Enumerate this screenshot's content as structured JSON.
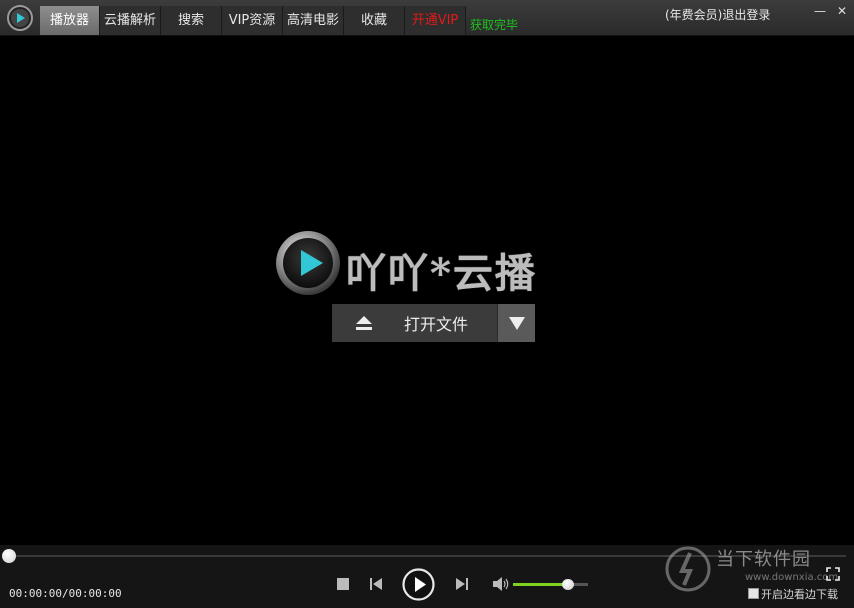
{
  "tabs": [
    "播放器",
    "云播解析",
    "搜索",
    "VIP资源",
    "高清电影",
    "收藏",
    "开通VIP"
  ],
  "status": "获取完毕",
  "account": "(年费会员)退出登录",
  "window_controls": {
    "minimize": "—",
    "close": "✕"
  },
  "brand": "吖吖*云播",
  "open_button": {
    "label": "打开文件"
  },
  "player": {
    "time": "00:00:00/00:00:00",
    "progress": 0,
    "volume": 0.72
  },
  "download_option": {
    "label": "开启边看边下载",
    "checked": false
  },
  "watermark": {
    "title": "当下软件园",
    "url": "www.downxia.com"
  },
  "colors": {
    "vip_tab": "#e21b1b",
    "status": "#1fc11f",
    "volume_fill": "#7ed321",
    "play_accent": "#31c7d6"
  }
}
